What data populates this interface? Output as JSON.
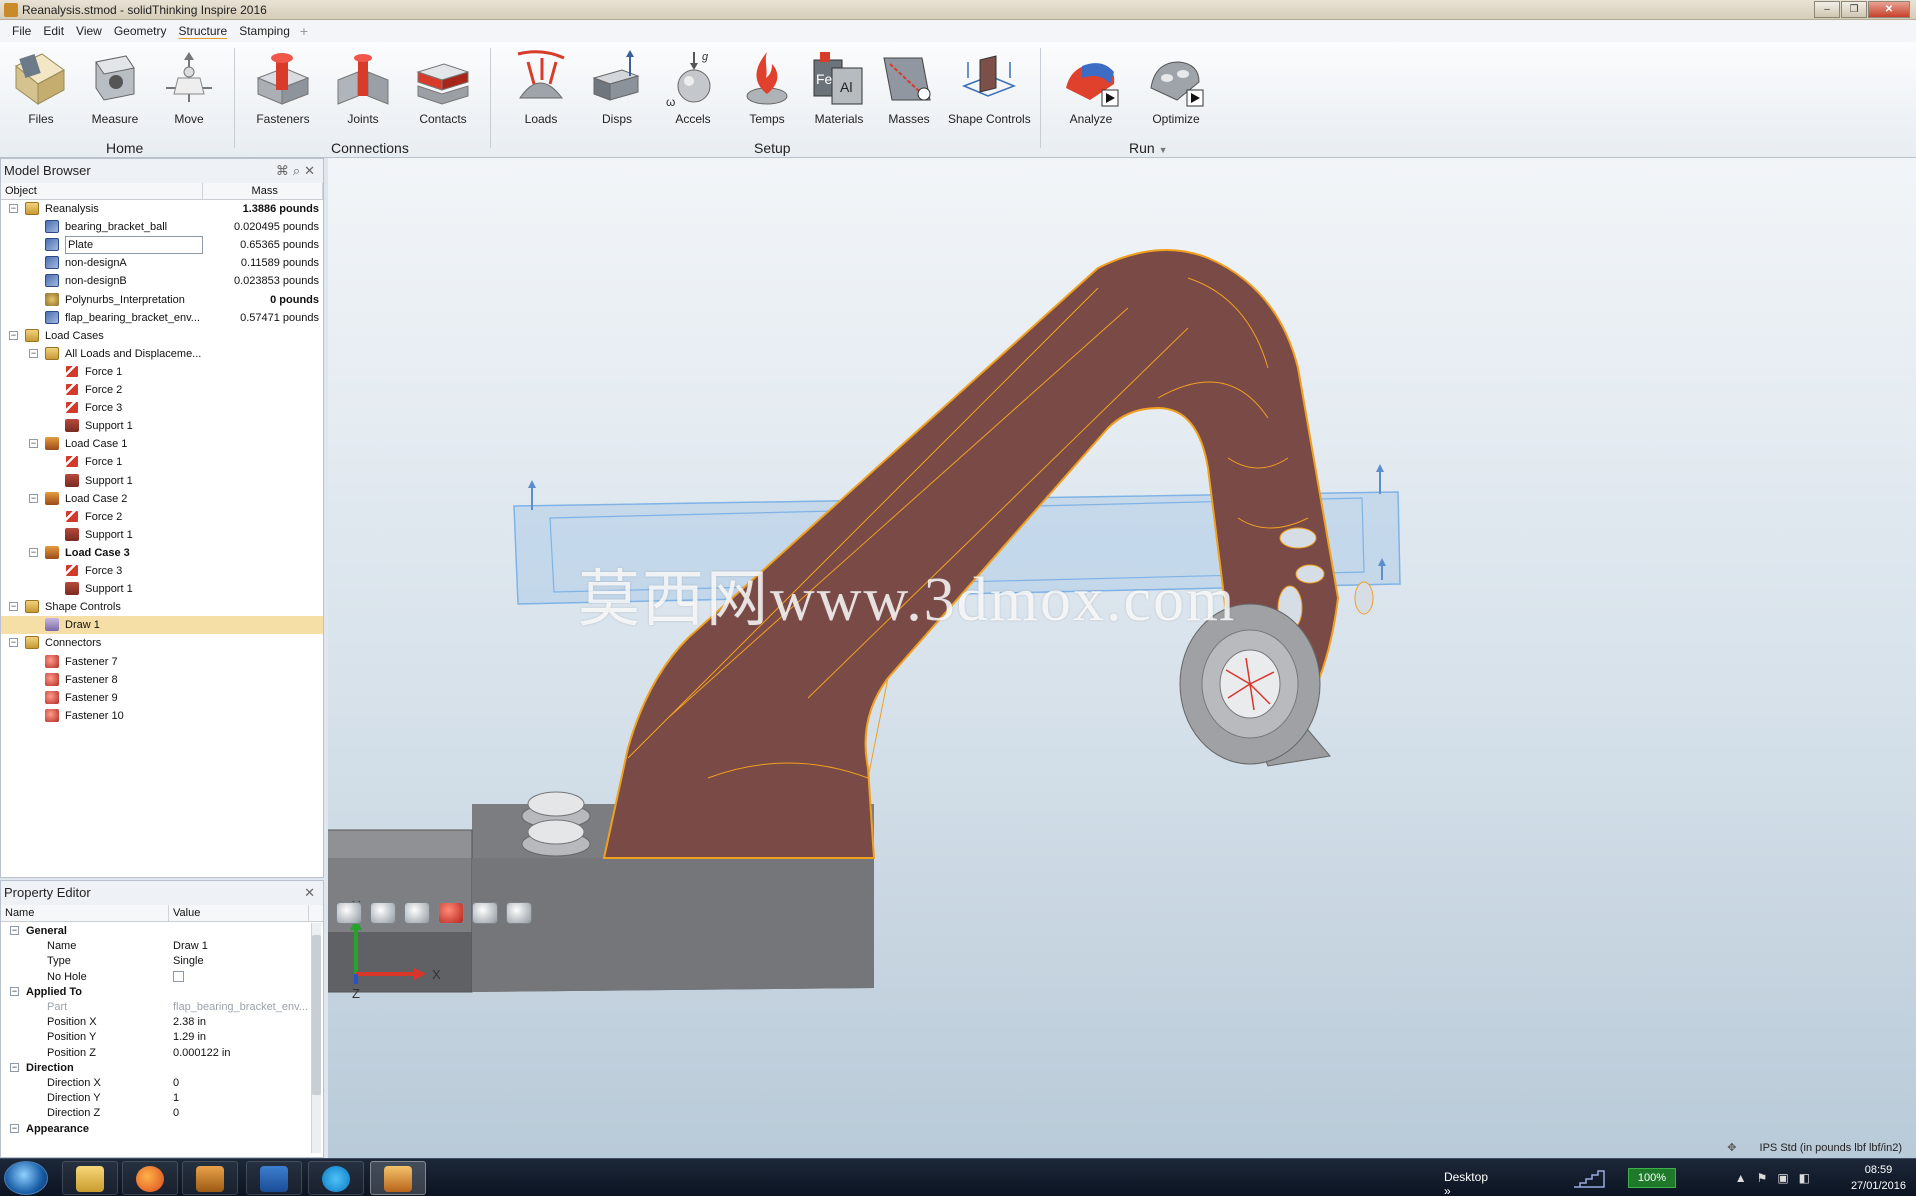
{
  "window": {
    "title": "Reanalysis.stmod - solidThinking Inspire 2016"
  },
  "menu": [
    "File",
    "Edit",
    "View",
    "Geometry",
    "Structure",
    "Stamping"
  ],
  "menu_active": "Structure",
  "ribbon": {
    "tools": [
      "Files",
      "Measure",
      "Move",
      "Fasteners",
      "Joints",
      "Contacts",
      "Loads",
      "Disps",
      "Accels",
      "Temps",
      "Materials",
      "Masses",
      "Shape Controls",
      "Analyze",
      "Optimize"
    ],
    "groups": [
      "Home",
      "Connections",
      "Setup",
      "Run"
    ],
    "run_dropdown": "▼",
    "accels_g": "g",
    "accels_w": "ω",
    "materials_fe": "Fe",
    "materials_al": "Al"
  },
  "model_browser": {
    "title": "Model Browser",
    "col_object": "Object",
    "col_mass": "Mass",
    "rows": [
      {
        "label": "Reanalysis",
        "mass": "1.3886 pounds",
        "mass_bold": true,
        "level": 0,
        "icon": "assembly-icon",
        "exp": "−"
      },
      {
        "label": "bearing_bracket_ball",
        "mass": "0.020495 pounds",
        "level": 1,
        "icon": "part-icon"
      },
      {
        "label": "Plate",
        "mass": "0.65365 pounds",
        "level": 1,
        "icon": "part-icon",
        "boxed": true
      },
      {
        "label": "non-designA",
        "mass": "0.11589 pounds",
        "level": 1,
        "icon": "part-icon"
      },
      {
        "label": "non-designB",
        "mass": "0.023853 pounds",
        "level": 1,
        "icon": "part-icon"
      },
      {
        "label": "Polynurbs_Interpretation",
        "mass": "0 pounds",
        "mass_bold": true,
        "level": 1,
        "icon": "polynurbs-icon"
      },
      {
        "label": "flap_bearing_bracket_env...",
        "mass": "0.57471 pounds",
        "level": 1,
        "icon": "part-icon"
      },
      {
        "label": "Load Cases",
        "level": 0,
        "icon": "folder-icon",
        "exp": "−"
      },
      {
        "label": "All Loads and Displaceme...",
        "level": 1,
        "icon": "folder-icon",
        "exp": "−"
      },
      {
        "label": "Force 1",
        "level": 2,
        "icon": "force-icon"
      },
      {
        "label": "Force 2",
        "level": 2,
        "icon": "force-icon"
      },
      {
        "label": "Force 3",
        "level": 2,
        "icon": "force-icon"
      },
      {
        "label": "Support 1",
        "level": 2,
        "icon": "support-icon"
      },
      {
        "label": "Load Case 1",
        "level": 1,
        "icon": "load-case-icon",
        "exp": "−"
      },
      {
        "label": "Force 1",
        "level": 2,
        "icon": "force-icon"
      },
      {
        "label": "Support 1",
        "level": 2,
        "icon": "support-icon"
      },
      {
        "label": "Load Case 2",
        "level": 1,
        "icon": "load-case-icon",
        "exp": "−"
      },
      {
        "label": "Force 2",
        "level": 2,
        "icon": "force-icon"
      },
      {
        "label": "Support 1",
        "level": 2,
        "icon": "support-icon"
      },
      {
        "label": "Load Case 3",
        "level": 1,
        "icon": "load-case-icon",
        "exp": "−",
        "bold": true
      },
      {
        "label": "Force 3",
        "level": 2,
        "icon": "force-icon"
      },
      {
        "label": "Support 1",
        "level": 2,
        "icon": "support-icon"
      },
      {
        "label": "Shape Controls",
        "level": 0,
        "icon": "folder-icon",
        "exp": "−"
      },
      {
        "label": "Draw 1",
        "level": 1,
        "icon": "shape-control-icon",
        "selected": true
      },
      {
        "label": "Connectors",
        "level": 0,
        "icon": "folder-icon",
        "exp": "−"
      },
      {
        "label": "Fastener 7",
        "level": 1,
        "icon": "fastener-icon"
      },
      {
        "label": "Fastener 8",
        "level": 1,
        "icon": "fastener-icon"
      },
      {
        "label": "Fastener 9",
        "level": 1,
        "icon": "fastener-icon"
      },
      {
        "label": "Fastener 10",
        "level": 1,
        "icon": "fastener-icon"
      }
    ]
  },
  "property_editor": {
    "title": "Property Editor",
    "col_name": "Name",
    "col_value": "Value",
    "rows": [
      {
        "group": true,
        "name": "General"
      },
      {
        "name": "Name",
        "value": "Draw 1"
      },
      {
        "name": "Type",
        "value": "Single"
      },
      {
        "name": "No Hole",
        "checkbox": true
      },
      {
        "group": true,
        "name": "Applied To"
      },
      {
        "name": "Part",
        "value": "flap_bearing_bracket_env...",
        "dim": true
      },
      {
        "name": "Position X",
        "value": "2.38 in"
      },
      {
        "name": "Position Y",
        "value": "1.29 in"
      },
      {
        "name": "Position Z",
        "value": "0.000122 in"
      },
      {
        "group": true,
        "name": "Direction"
      },
      {
        "name": "Direction X",
        "value": "0"
      },
      {
        "name": "Direction Y",
        "value": "1"
      },
      {
        "name": "Direction Z",
        "value": "0"
      },
      {
        "group": true,
        "name": "Appearance"
      }
    ]
  },
  "viewport": {
    "watermark": "莫西网www.3dmox.com",
    "axis_x": "X",
    "axis_y": "Y",
    "axis_z": "Z",
    "bracket_color": "#7a4a46",
    "edge_color": "#f0a021"
  },
  "status": {
    "units": "IPS Std (in pounds lbf lbf/in2)"
  },
  "taskbar": {
    "desktop": "Desktop",
    "battery": "100%",
    "time": "08:59",
    "date": "27/01/2016",
    "apps": [
      "explorer-icon",
      "firefox-icon",
      "media-player-icon",
      "outlook-icon",
      "skype-icon",
      "inspire-icon"
    ]
  }
}
